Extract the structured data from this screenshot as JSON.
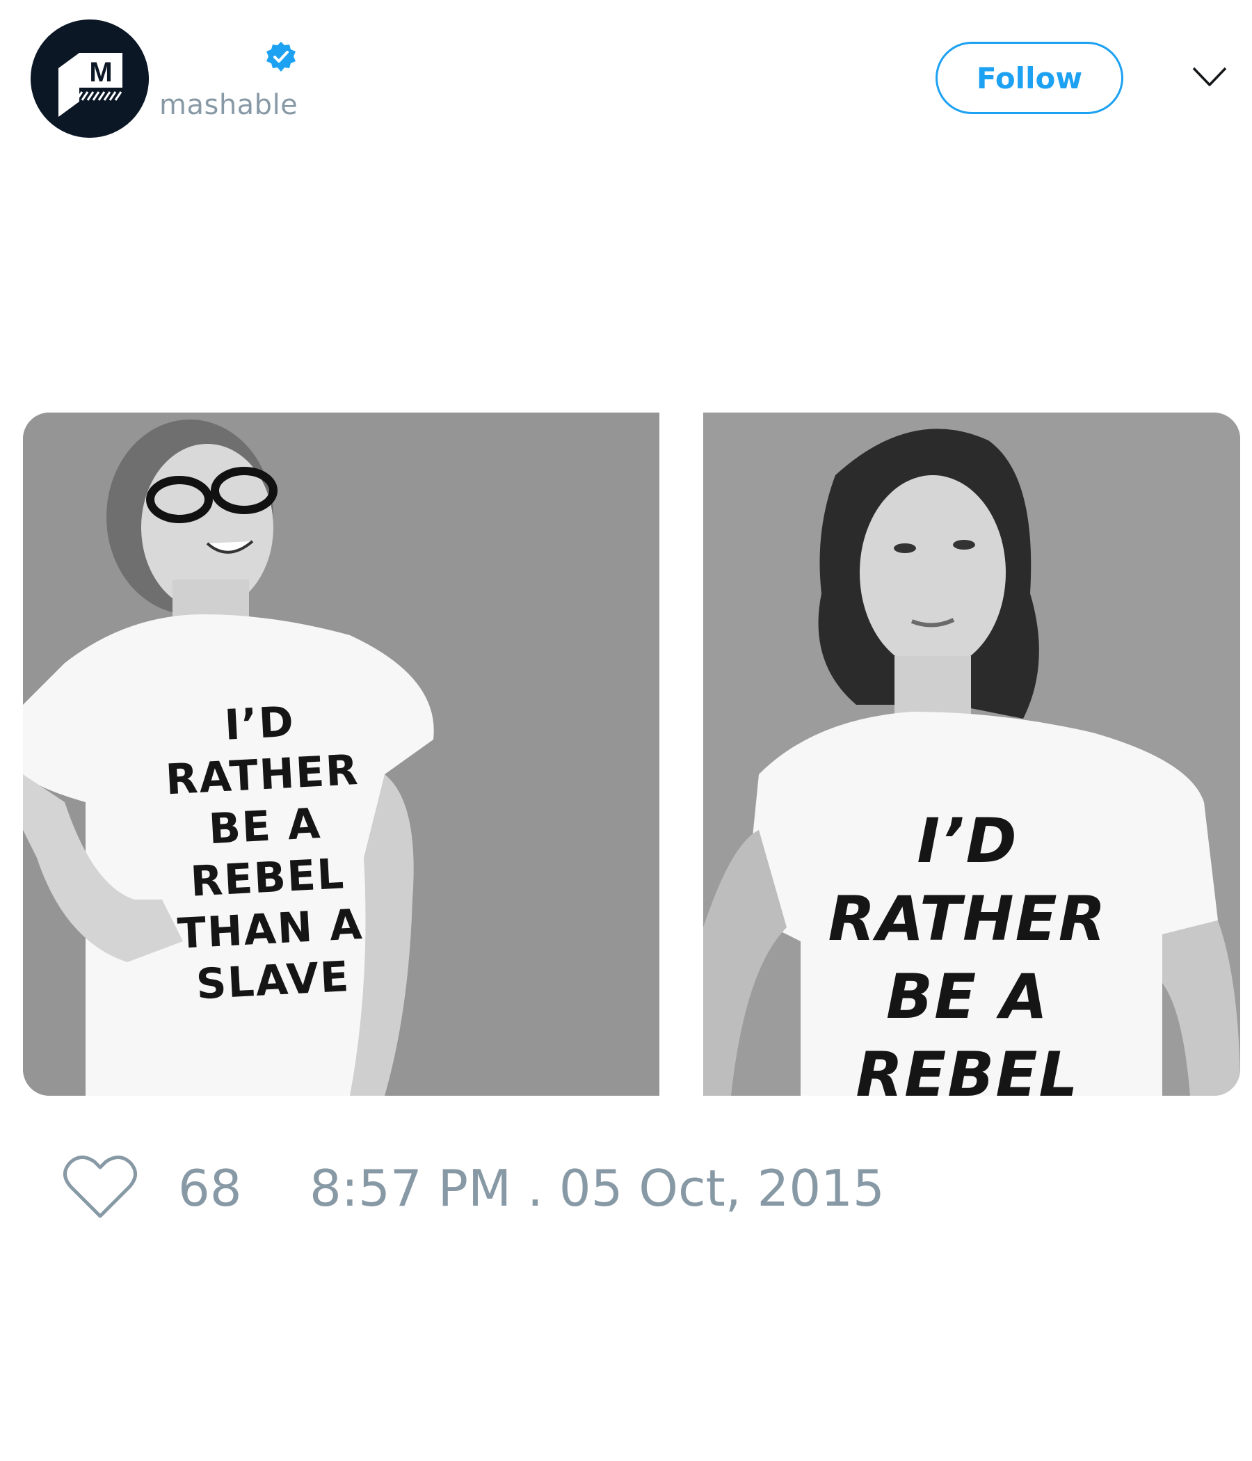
{
  "account": {
    "handle": "mashable",
    "verified": true,
    "avatar_icon": "mashable-logo-icon"
  },
  "header": {
    "follow_label": "Follow",
    "menu_icon": "chevron-down-icon"
  },
  "media": {
    "photos": [
      {
        "shirt_lines": [
          "I’D",
          "RATHER",
          "BE A",
          "REBEL",
          "THAN A",
          "SLAVE"
        ]
      },
      {
        "shirt_lines": [
          "I’D",
          "RATHER",
          "BE A",
          "REBEL"
        ]
      }
    ]
  },
  "footer": {
    "like_icon": "heart-icon",
    "like_count": "68",
    "timestamp": "8:57 PM . 05 Oct, 2015"
  },
  "colors": {
    "accent": "#1da1f2",
    "muted_text": "#8899a6",
    "avatar_bg": "#0c1726"
  }
}
